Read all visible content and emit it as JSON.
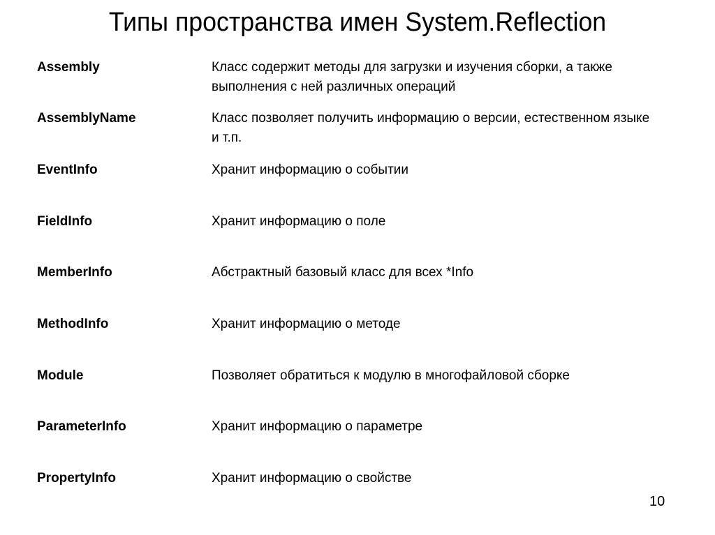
{
  "slide": {
    "title": "Типы пространства имен System.Reflection",
    "page_number": "10",
    "rows": [
      {
        "term": "Assembly",
        "description": "Класс содержит методы для загрузки и изучения сборки, а также выполнения с ней различных операций"
      },
      {
        "term": "AssemblyName",
        "description": "Класс позволяет получить информацию о версии, естественном языке и т.п."
      },
      {
        "term": "EventInfo",
        "description": "Хранит информацию о событии"
      },
      {
        "term": "FieldInfo",
        "description": "Хранит информацию о поле"
      },
      {
        "term": "MemberInfo",
        "description": "Абстрактный базовый класс для всех *Info"
      },
      {
        "term": "MethodInfo",
        "description": "Хранит информацию о методе"
      },
      {
        "term": "Module",
        "description": "Позволяет обратиться к модулю в многофайловой сборке"
      },
      {
        "term": "ParameterInfo",
        "description": "Хранит информацию о параметре"
      },
      {
        "term": "PropertyInfo",
        "description": "Хранит информацию о свойстве"
      }
    ]
  }
}
